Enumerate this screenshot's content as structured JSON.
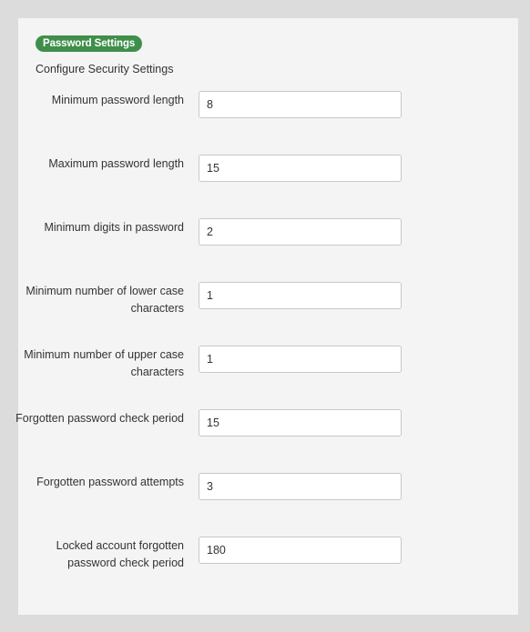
{
  "section": {
    "badge": "Password Settings",
    "subtitle": "Configure Security Settings"
  },
  "fields": [
    {
      "label": "Minimum password length",
      "value": "8"
    },
    {
      "label": "Maximum password length",
      "value": "15"
    },
    {
      "label": "Minimum digits in password",
      "value": "2"
    },
    {
      "label": "Minimum number of lower case characters",
      "value": "1"
    },
    {
      "label": "Minimum number of upper case characters",
      "value": "1"
    },
    {
      "label": "Forgotten password check period",
      "value": "15"
    },
    {
      "label": "Forgotten password attempts",
      "value": "3"
    },
    {
      "label": "Locked account forgotten password check period",
      "value": "180"
    }
  ],
  "colors": {
    "badge": "#3f8f4b",
    "panel": "#f4f4f4",
    "page": "#dcdcdc"
  }
}
